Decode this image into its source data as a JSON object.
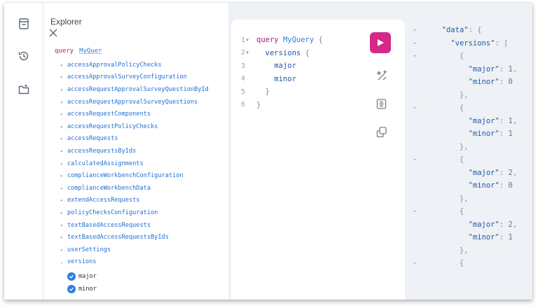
{
  "explorer": {
    "title": "Explorer",
    "query_keyword": "query",
    "query_name": "MyQuer",
    "fields": [
      "accessApprovalPolicyChecks",
      "accessApprovalSurveyConfiguration",
      "accessRequestApprovalSurveyQuestionById",
      "accessRequestApprovalSurveyQuestions",
      "accessRequestComponents",
      "accessRequestPolicyChecks",
      "accessRequests",
      "accessRequestsByIds",
      "calculatedAssignments",
      "complianceWorkbenchConfiguration",
      "complianceWorkbenchData",
      "extendAccessRequests",
      "policyChecksConfiguration",
      "textBasedAccessRequests",
      "textBasedAccessRequestsByIds",
      "userSettings",
      "versions"
    ],
    "subfields": [
      "major",
      "minor"
    ]
  },
  "editor": {
    "lines": [
      {
        "n": "1",
        "fold": "▾",
        "parts": [
          {
            "t": "query",
            "c": "kw"
          },
          {
            "t": " ",
            "c": "pn"
          },
          {
            "t": "MyQuery",
            "c": "nm"
          },
          {
            "t": " {",
            "c": "pn"
          }
        ]
      },
      {
        "n": "2",
        "fold": "▾",
        "parts": [
          {
            "t": "  versions",
            "c": "fd"
          },
          {
            "t": " {",
            "c": "pn"
          }
        ]
      },
      {
        "n": "3",
        "fold": " ",
        "parts": [
          {
            "t": "    major",
            "c": "fd"
          }
        ]
      },
      {
        "n": "4",
        "fold": " ",
        "parts": [
          {
            "t": "    minor",
            "c": "fd"
          }
        ]
      },
      {
        "n": "5",
        "fold": " ",
        "parts": [
          {
            "t": "  }",
            "c": "pn"
          }
        ]
      },
      {
        "n": "6",
        "fold": " ",
        "parts": [
          {
            "t": "}",
            "c": "pn"
          }
        ]
      }
    ]
  },
  "result": {
    "lines": [
      {
        "f": "▾",
        "parts": [
          {
            "t": "  ",
            "c": "rp"
          },
          {
            "t": "\"data\"",
            "c": "rk"
          },
          {
            "t": ": {",
            "c": "rp"
          }
        ]
      },
      {
        "f": "▾",
        "parts": [
          {
            "t": "    ",
            "c": "rp"
          },
          {
            "t": "\"versions\"",
            "c": "rk"
          },
          {
            "t": ": [",
            "c": "rp"
          }
        ]
      },
      {
        "f": "▾",
        "parts": [
          {
            "t": "      {",
            "c": "rp"
          }
        ]
      },
      {
        "f": " ",
        "parts": [
          {
            "t": "        ",
            "c": "rp"
          },
          {
            "t": "\"major\"",
            "c": "rk"
          },
          {
            "t": ": ",
            "c": "rp"
          },
          {
            "t": "1",
            "c": "rv"
          },
          {
            "t": ",",
            "c": "rp"
          }
        ]
      },
      {
        "f": " ",
        "parts": [
          {
            "t": "        ",
            "c": "rp"
          },
          {
            "t": "\"minor\"",
            "c": "rk"
          },
          {
            "t": ": ",
            "c": "rp"
          },
          {
            "t": "0",
            "c": "rv"
          }
        ]
      },
      {
        "f": " ",
        "parts": [
          {
            "t": "      },",
            "c": "rp"
          }
        ]
      },
      {
        "f": "▾",
        "parts": [
          {
            "t": "      {",
            "c": "rp"
          }
        ]
      },
      {
        "f": " ",
        "parts": [
          {
            "t": "        ",
            "c": "rp"
          },
          {
            "t": "\"major\"",
            "c": "rk"
          },
          {
            "t": ": ",
            "c": "rp"
          },
          {
            "t": "1",
            "c": "rv"
          },
          {
            "t": ",",
            "c": "rp"
          }
        ]
      },
      {
        "f": " ",
        "parts": [
          {
            "t": "        ",
            "c": "rp"
          },
          {
            "t": "\"minor\"",
            "c": "rk"
          },
          {
            "t": ": ",
            "c": "rp"
          },
          {
            "t": "1",
            "c": "rv"
          }
        ]
      },
      {
        "f": " ",
        "parts": [
          {
            "t": "      },",
            "c": "rp"
          }
        ]
      },
      {
        "f": "▾",
        "parts": [
          {
            "t": "      {",
            "c": "rp"
          }
        ]
      },
      {
        "f": " ",
        "parts": [
          {
            "t": "        ",
            "c": "rp"
          },
          {
            "t": "\"major\"",
            "c": "rk"
          },
          {
            "t": ": ",
            "c": "rp"
          },
          {
            "t": "2",
            "c": "rv"
          },
          {
            "t": ",",
            "c": "rp"
          }
        ]
      },
      {
        "f": " ",
        "parts": [
          {
            "t": "        ",
            "c": "rp"
          },
          {
            "t": "\"minor\"",
            "c": "rk"
          },
          {
            "t": ": ",
            "c": "rp"
          },
          {
            "t": "0",
            "c": "rv"
          }
        ]
      },
      {
        "f": " ",
        "parts": [
          {
            "t": "      },",
            "c": "rp"
          }
        ]
      },
      {
        "f": "▾",
        "parts": [
          {
            "t": "      {",
            "c": "rp"
          }
        ]
      },
      {
        "f": " ",
        "parts": [
          {
            "t": "        ",
            "c": "rp"
          },
          {
            "t": "\"major\"",
            "c": "rk"
          },
          {
            "t": ": ",
            "c": "rp"
          },
          {
            "t": "2",
            "c": "rv"
          },
          {
            "t": ",",
            "c": "rp"
          }
        ]
      },
      {
        "f": " ",
        "parts": [
          {
            "t": "        ",
            "c": "rp"
          },
          {
            "t": "\"minor\"",
            "c": "rk"
          },
          {
            "t": ": ",
            "c": "rp"
          },
          {
            "t": "1",
            "c": "rv"
          }
        ]
      },
      {
        "f": " ",
        "parts": [
          {
            "t": "      },",
            "c": "rp"
          }
        ]
      },
      {
        "f": "▾",
        "parts": [
          {
            "t": "      {",
            "c": "rp"
          }
        ]
      }
    ]
  },
  "colors": {
    "accent": "#d3298a",
    "link": "#1f6fd0",
    "check": "#2d7fe0"
  }
}
